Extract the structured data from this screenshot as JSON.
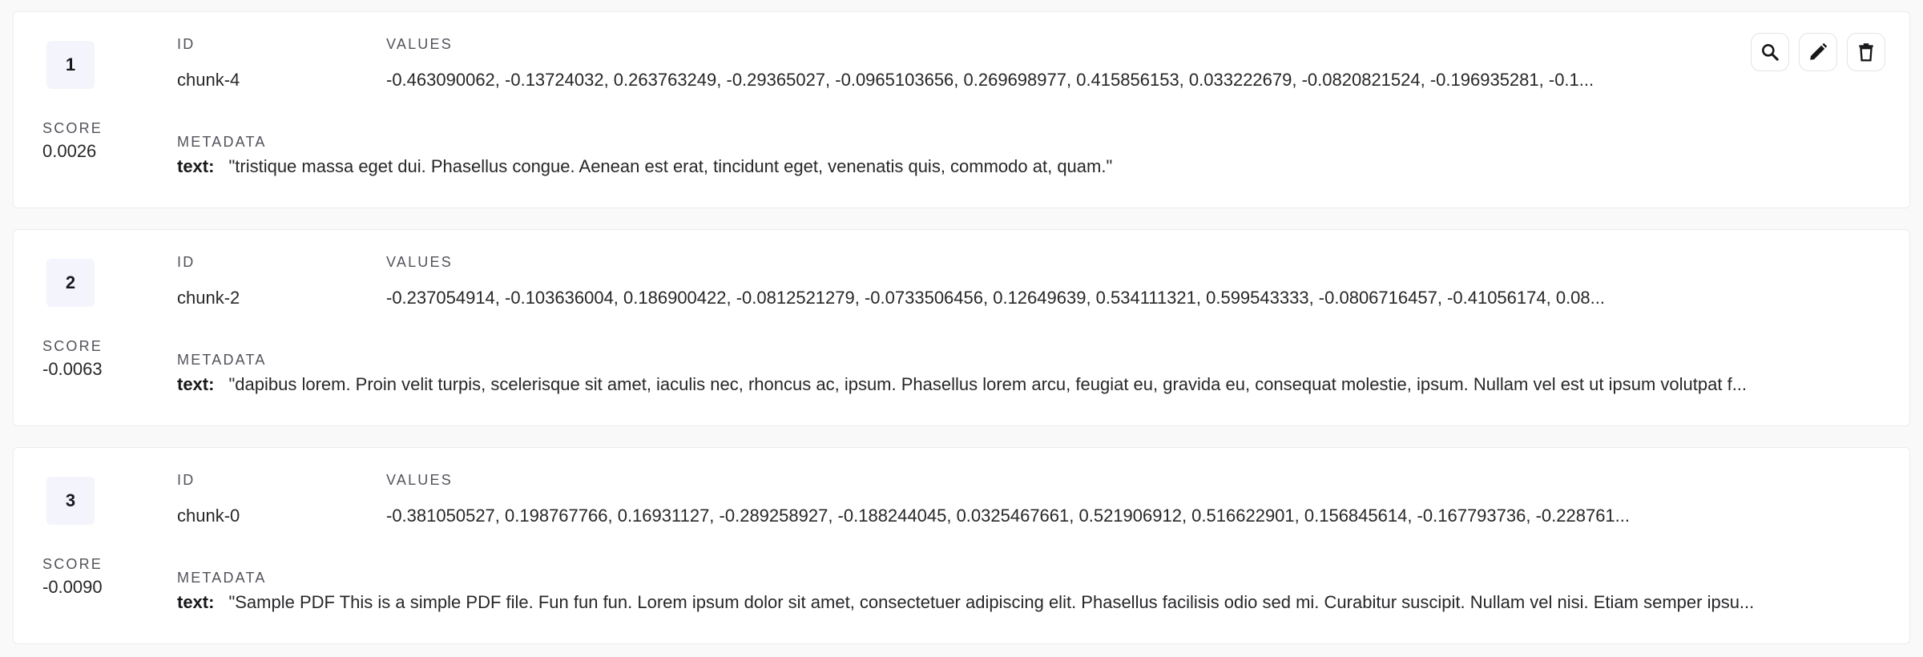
{
  "labels": {
    "score": "SCORE",
    "id": "ID",
    "values": "VALUES",
    "metadata": "METADATA"
  },
  "actions": {
    "search_icon": "search-icon",
    "edit_icon": "pencil-icon",
    "delete_icon": "trash-icon"
  },
  "results": [
    {
      "rank": "1",
      "score": "0.0026",
      "id": "chunk-4",
      "values": "-0.463090062, -0.13724032, 0.263763249, -0.29365027, -0.0965103656, 0.269698977, 0.415856153, 0.033222679, -0.0820821524, -0.196935281, -0.1...",
      "meta_key": "text:",
      "meta_value": "\"tristique massa eget dui. Phasellus congue. Aenean est erat, tincidunt eget, venenatis quis, commodo at, quam.\""
    },
    {
      "rank": "2",
      "score": "-0.0063",
      "id": "chunk-2",
      "values": "-0.237054914, -0.103636004, 0.186900422, -0.0812521279, -0.0733506456, 0.12649639, 0.534111321, 0.599543333, -0.0806716457, -0.41056174, 0.08...",
      "meta_key": "text:",
      "meta_value": "\"dapibus lorem. Proin velit turpis, scelerisque sit amet, iaculis nec, rhoncus ac, ipsum. Phasellus lorem arcu, feugiat eu, gravida eu, consequat molestie, ipsum. Nullam vel est ut ipsum volutpat f..."
    },
    {
      "rank": "3",
      "score": "-0.0090",
      "id": "chunk-0",
      "values": "-0.381050527, 0.198767766, 0.16931127, -0.289258927, -0.188244045, 0.0325467661, 0.521906912, 0.516622901, 0.156845614, -0.167793736, -0.228761...",
      "meta_key": "text:",
      "meta_value": "\"Sample PDF This is a simple PDF file. Fun fun fun. Lorem ipsum dolor sit amet, consectetuer adipiscing elit. Phasellus facilisis odio sed mi. Curabitur suscipit. Nullam vel nisi. Etiam semper ipsu..."
    }
  ]
}
